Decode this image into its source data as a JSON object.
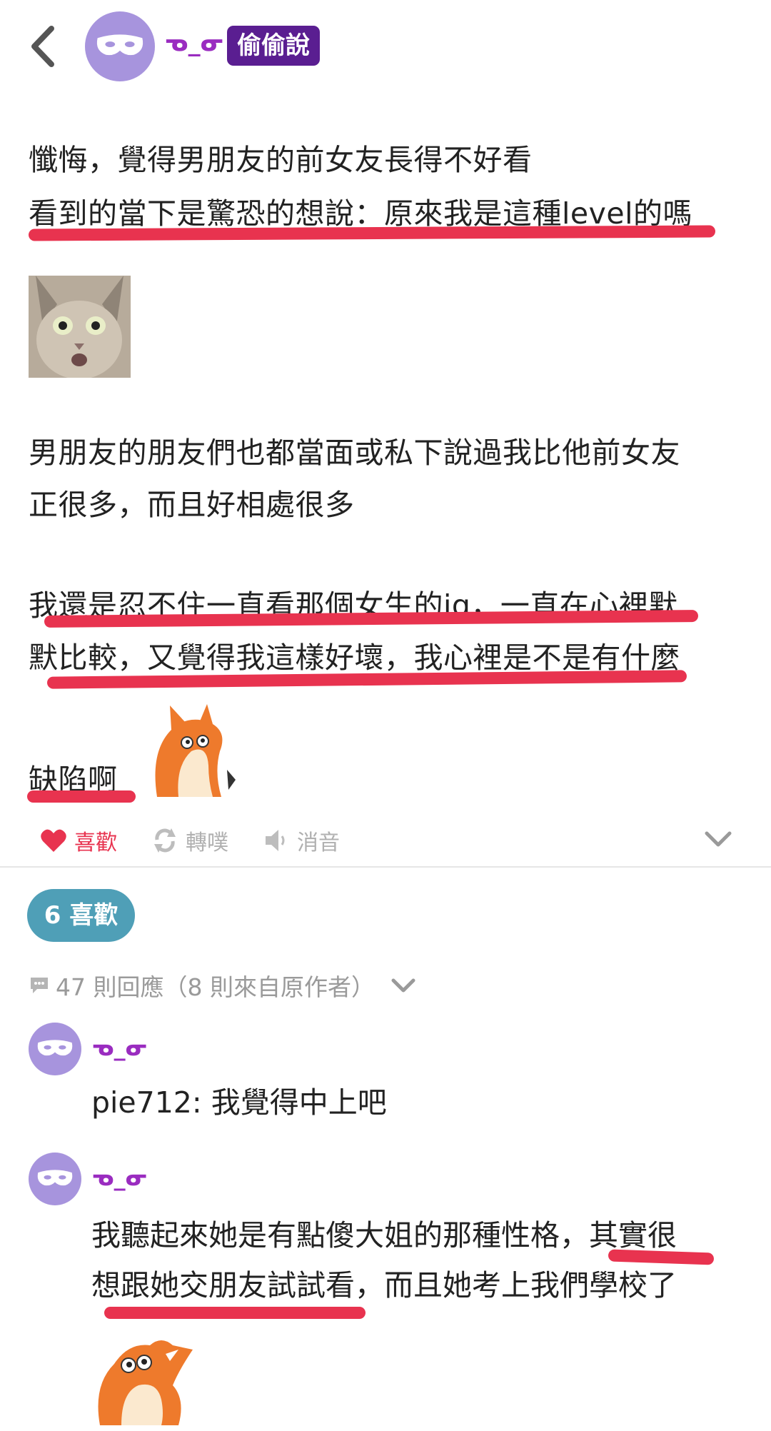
{
  "header": {
    "author_name": "ᓀ_ᓂ",
    "badge": "偷偷說"
  },
  "post": {
    "lines": [
      "懺悔，覺得男朋友的前女友長得不好看",
      "看到的當下是驚恐的想說：原來我是這種level的嗎",
      "男朋友的朋友們也都當面或私下說過我比他前女友",
      "正很多，而且好相處很多",
      "我還是忍不住一直看那個女生的ig，一直在心裡默",
      "默比較，又覺得我這樣好壞，我心裡是不是有什麼",
      "缺陷啊"
    ]
  },
  "actions": {
    "like": "喜歡",
    "repost": "轉噗",
    "mute": "消音"
  },
  "likes_pill": "6 喜歡",
  "replies": {
    "count_label": "47 則回應（8 則來自原作者）",
    "items": [
      {
        "author": "ᓀ_ᓂ",
        "lines": [
          "pie712: 我覺得中上吧"
        ]
      },
      {
        "author": "ᓀ_ᓂ",
        "lines": [
          "我聽起來她是有點傻大姐的那種性格，其實很",
          "想跟她交朋友試試看，而且她考上我們學校了"
        ]
      }
    ]
  },
  "colors": {
    "accent_red": "#e8334f",
    "avatar": "#a794dd",
    "badge": "#5a1e91",
    "like_pill": "#4f9fb7",
    "username": "#9a2cc0"
  }
}
